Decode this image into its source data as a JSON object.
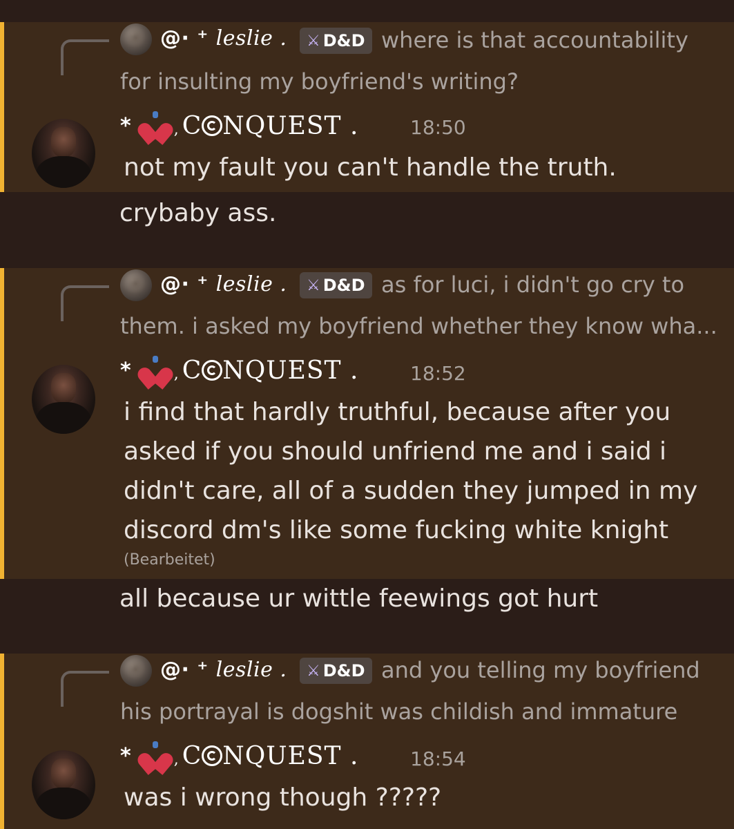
{
  "reply_author": {
    "symbols": "@· ⁺",
    "name": "leslie .",
    "tag": "D&D"
  },
  "author": {
    "star": "*",
    "nick_prefix": ",",
    "nick_start": "C",
    "nick_end": "NQUEST .",
    "heart_icon": "anatomical-heart-emoji",
    "spiral_icon": "spiral-o"
  },
  "messages": [
    {
      "reply_text_line1": "where is that accountability",
      "reply_text_line2": "for insulting my boyfriend's writing?",
      "time": "18:50",
      "lines": [
        "not my fault you can't handle the truth."
      ],
      "followup": "crybaby ass."
    },
    {
      "reply_text_line1": "as for luci, i didn't go cry to",
      "reply_text_line2": "them. i asked my boyfriend whether they know wha...",
      "time": "18:52",
      "lines": [
        "i find that hardly truthful, because after you",
        "asked if you should unfriend me and i said i",
        "didn't care, all of a sudden they jumped in my",
        "discord dm's like some fucking white knight"
      ],
      "edited": "(Bearbeitet)",
      "followup": "all because ur wittle feewings got hurt"
    },
    {
      "reply_text_line1": "and you telling my boyfriend",
      "reply_text_line2": "his portrayal is dogshit was childish and immature",
      "time": "18:54",
      "lines": [
        "was i wrong though ?????"
      ]
    }
  ],
  "colors": {
    "background": "#2b1d18",
    "mention_highlight": "#3d2a1a",
    "mention_bar": "#f0b232"
  }
}
